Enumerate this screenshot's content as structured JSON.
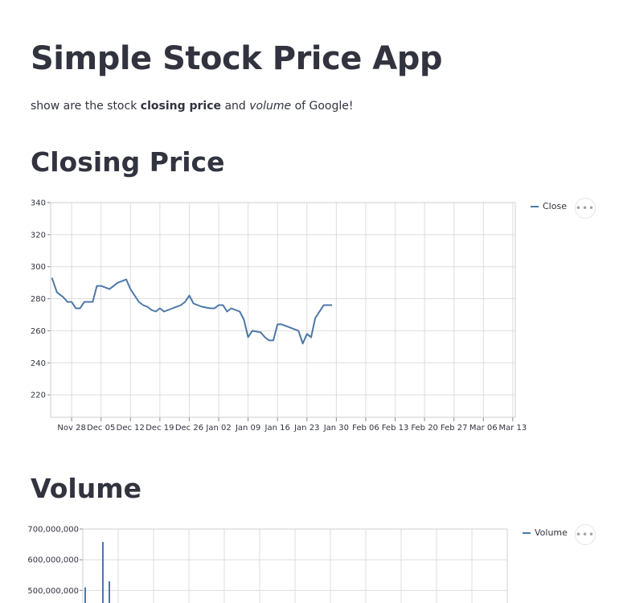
{
  "page": {
    "title": "Simple Stock Price App",
    "subtitle": {
      "prefix": "show are the stock ",
      "bold": "closing price",
      "middle": " and ",
      "italic": "volume",
      "suffix": " of Google!"
    },
    "closing_header": "Closing Price",
    "volume_header": "Volume"
  },
  "menu_icon": "more-horizontal-icon",
  "colors": {
    "line": "#4c78a8",
    "grid": "#dddddd",
    "text": "#31333f"
  },
  "chart_data": [
    {
      "type": "line",
      "legend": "Close",
      "legend_position": "top-right",
      "grid": true,
      "ylim": [
        206,
        340
      ],
      "yticks": [
        220,
        240,
        260,
        280,
        300,
        320,
        340
      ],
      "x_ticks": [
        "Nov 28",
        "Dec 05",
        "Dec 12",
        "Dec 19",
        "Dec 26",
        "Jan 02",
        "Jan 09",
        "Jan 16",
        "Jan 23",
        "Jan 30",
        "Feb 06",
        "Feb 13",
        "Feb 20",
        "Feb 27",
        "Mar 06",
        "Mar 13"
      ],
      "x_start_day": -5.0,
      "x_end_day": 105.6,
      "series": [
        {
          "name": "Close",
          "x_days": [
            -4.7,
            -3.5,
            -2,
            -1,
            0,
            1,
            2,
            3,
            5,
            6,
            7,
            9,
            11,
            13,
            14,
            16,
            17,
            18,
            19,
            20,
            21,
            22,
            24,
            26,
            27,
            28,
            29,
            31,
            33,
            34,
            35,
            36,
            37,
            38,
            39,
            40,
            41,
            42,
            43,
            45,
            46,
            47,
            48,
            49,
            50,
            52,
            53,
            54,
            55,
            56,
            57,
            58,
            60,
            62
          ],
          "values": [
            293,
            284,
            281,
            278,
            278,
            274,
            274,
            278,
            278,
            288,
            288,
            286,
            290,
            292,
            286,
            278,
            276,
            275,
            273,
            272,
            274,
            272,
            274,
            276,
            278,
            282,
            277,
            275,
            274,
            274,
            276,
            276,
            272,
            274,
            273,
            272,
            267,
            256,
            260,
            259,
            256,
            254,
            254,
            264,
            264,
            262,
            261,
            260,
            252,
            258,
            256,
            268,
            276,
            276,
            282
          ]
        }
      ]
    },
    {
      "type": "line",
      "legend": "Volume",
      "legend_position": "top-right",
      "grid": true,
      "ylim": [
        400000000,
        700000000
      ],
      "yticks": [
        "700,000,000",
        "600,000,000",
        "500,000,000"
      ],
      "series": [
        {
          "name": "Volume",
          "spikes": [
            {
              "x_frac": 0.0,
              "value": 510000000
            },
            {
              "x_frac": 0.05,
              "value": 658000000
            },
            {
              "x_frac": 0.07,
              "value": 530000000
            }
          ]
        }
      ]
    }
  ]
}
